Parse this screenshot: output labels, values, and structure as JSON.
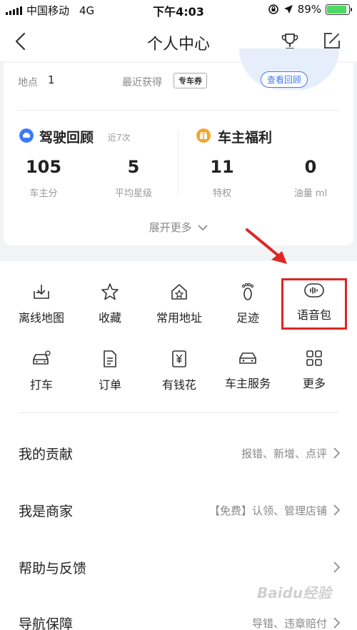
{
  "status_bar": {
    "carrier": "中国移动",
    "network": "4G",
    "time": "下午4:03",
    "battery_percent": "89%",
    "battery_level": 0.89
  },
  "header": {
    "title": "个人中心"
  },
  "card": {
    "location_label": "地点",
    "location_value": "1",
    "recent_label": "最近获得",
    "recent_badge": "专车券",
    "view_review_label": "查看回顾",
    "driving": {
      "title": "驾驶回顾",
      "subtitle": "近7次",
      "icon_color": "#3b7bf6",
      "stats": [
        {
          "value": "105",
          "label": "车主分"
        },
        {
          "value": "5",
          "label": "平均星级"
        }
      ]
    },
    "owner": {
      "title": "车主福利",
      "icon_color": "#f5a623",
      "stats": [
        {
          "value": "11",
          "label": "特权"
        },
        {
          "value": "0",
          "label": "油量 ml"
        }
      ]
    },
    "expand_label": "展开更多"
  },
  "grid": [
    {
      "label": "离线地图",
      "icon": "download-map-icon"
    },
    {
      "label": "收藏",
      "icon": "star-icon"
    },
    {
      "label": "常用地址",
      "icon": "home-star-icon"
    },
    {
      "label": "足迹",
      "icon": "footprint-icon"
    },
    {
      "label": "语音包",
      "icon": "voice-wave-icon"
    },
    {
      "label": "打车",
      "icon": "taxi-icon"
    },
    {
      "label": "订单",
      "icon": "order-doc-icon"
    },
    {
      "label": "有钱花",
      "icon": "yuan-icon"
    },
    {
      "label": "车主服务",
      "icon": "car-icon"
    },
    {
      "label": "更多",
      "icon": "grid-more-icon"
    }
  ],
  "rows": [
    {
      "title": "我的贡献",
      "desc": "报错、新增、点评"
    },
    {
      "title": "我是商家",
      "desc": "【免费】认领、管理店铺"
    },
    {
      "title": "帮助与反馈",
      "desc": ""
    },
    {
      "title": "导航保障",
      "desc": "导错、违章赔付"
    }
  ],
  "watermark": "Baidu经验",
  "colors": {
    "accent_blue": "#3b7bf6",
    "accent_orange": "#f5a623",
    "highlight_red": "#e02525",
    "battery_green": "#4cd964"
  }
}
